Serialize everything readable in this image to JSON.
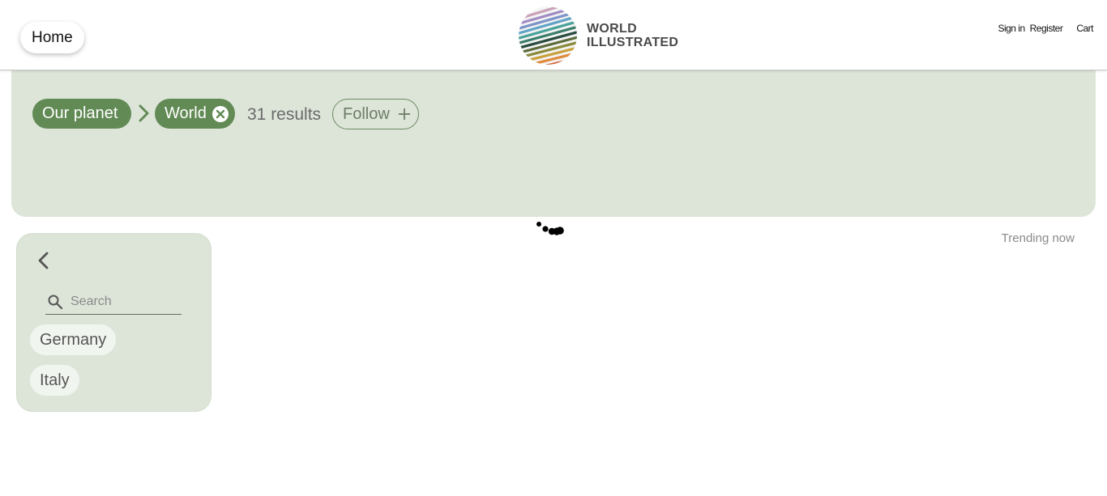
{
  "header": {
    "home_label": "Home",
    "logo_line1": "WORLD",
    "logo_line2": "ILLUSTRATED",
    "sign_in_label": "Sign in",
    "register_label": "Register",
    "cart_label": "Cart"
  },
  "filters": {
    "breadcrumb": [
      {
        "label": "Our planet"
      },
      {
        "label": "World"
      }
    ],
    "results_count": "31 results",
    "follow_label": "Follow",
    "chip_color": "#628a55",
    "panel_color": "#dde5d9"
  },
  "trending_label": "Trending now",
  "sidebar": {
    "search_placeholder": "Search",
    "search_value": "",
    "items": [
      {
        "label": "Germany"
      },
      {
        "label": "Italy"
      }
    ]
  }
}
